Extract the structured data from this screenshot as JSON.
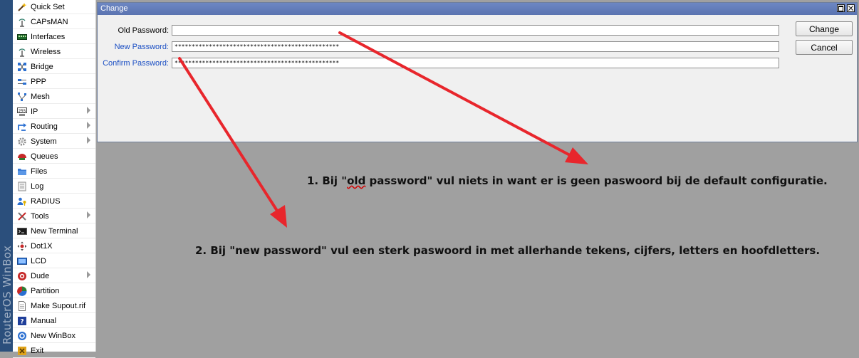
{
  "brand": {
    "text": "RouterOS WinBox"
  },
  "menu": {
    "items": [
      {
        "label": "Quick Set",
        "icon": "wand-icon",
        "submenu": false
      },
      {
        "label": "CAPsMAN",
        "icon": "antenna-icon",
        "submenu": false
      },
      {
        "label": "Interfaces",
        "icon": "interfaces-icon",
        "submenu": false
      },
      {
        "label": "Wireless",
        "icon": "antenna-icon",
        "submenu": false
      },
      {
        "label": "Bridge",
        "icon": "bridge-icon",
        "submenu": false
      },
      {
        "label": "PPP",
        "icon": "ppp-icon",
        "submenu": false
      },
      {
        "label": "Mesh",
        "icon": "mesh-icon",
        "submenu": false
      },
      {
        "label": "IP",
        "icon": "ip-icon",
        "submenu": true
      },
      {
        "label": "Routing",
        "icon": "routing-icon",
        "submenu": true
      },
      {
        "label": "System",
        "icon": "gear-icon",
        "submenu": true
      },
      {
        "label": "Queues",
        "icon": "queues-icon",
        "submenu": false
      },
      {
        "label": "Files",
        "icon": "folder-icon",
        "submenu": false
      },
      {
        "label": "Log",
        "icon": "log-icon",
        "submenu": false
      },
      {
        "label": "RADIUS",
        "icon": "radius-icon",
        "submenu": false
      },
      {
        "label": "Tools",
        "icon": "tools-icon",
        "submenu": true
      },
      {
        "label": "New Terminal",
        "icon": "terminal-icon",
        "submenu": false
      },
      {
        "label": "Dot1X",
        "icon": "dot1x-icon",
        "submenu": false
      },
      {
        "label": "LCD",
        "icon": "lcd-icon",
        "submenu": false
      },
      {
        "label": "Dude",
        "icon": "dude-icon",
        "submenu": true
      },
      {
        "label": "Partition",
        "icon": "partition-icon",
        "submenu": false
      },
      {
        "label": "Make Supout.rif",
        "icon": "document-icon",
        "submenu": false
      },
      {
        "label": "Manual",
        "icon": "manual-icon",
        "submenu": false
      },
      {
        "label": "New WinBox",
        "icon": "winbox-icon",
        "submenu": false
      },
      {
        "label": "Exit",
        "icon": "exit-icon",
        "submenu": false
      }
    ]
  },
  "window": {
    "title": "Change",
    "fields": [
      {
        "label": "Old Password:",
        "value": ""
      },
      {
        "label": "New Password:",
        "value": "************************************************"
      },
      {
        "label": "Confirm Password:",
        "value": "************************************************"
      }
    ],
    "buttons": {
      "change": "Change",
      "cancel": "Cancel"
    }
  },
  "annotations": {
    "note1": {
      "prefix": "1. Bij \"",
      "squiggle": "old",
      "suffix": " password\" vul niets in want er is geen paswoord bij de default configuratie."
    },
    "note2": {
      "text": "2. Bij \"new password\" vul een sterk paswoord in met allerhande tekens, cijfers, letters en hoofdletters."
    }
  },
  "colors": {
    "arrow": "#e8262c",
    "title_bar": "#5e78b6",
    "workspace": "#a0a0a0",
    "label_accent": "#1b4fc4"
  }
}
